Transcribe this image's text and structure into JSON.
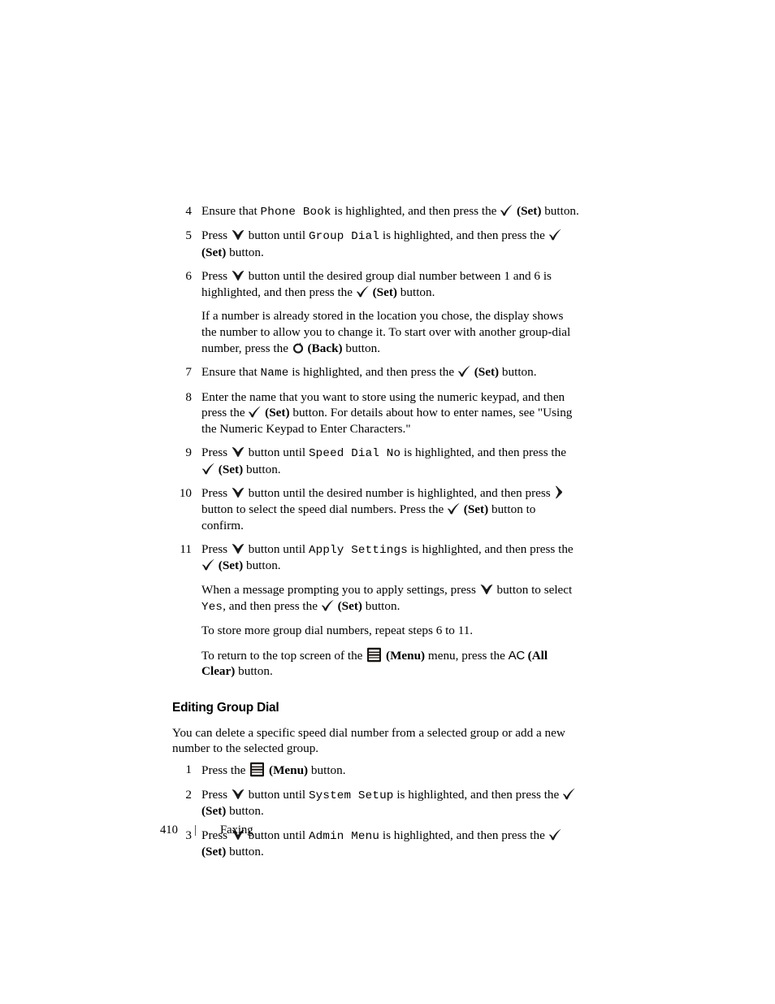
{
  "document": {
    "footer": {
      "page_number": "410",
      "separator": "|",
      "section": "Faxing"
    }
  },
  "icons": {
    "set": "checkmark-icon",
    "down": "down-arrow-icon",
    "back": "back-circular-arrow-icon",
    "right": "right-chevron-icon",
    "menu": "menu-icon",
    "all_clear": "AC"
  },
  "procedure_continued": {
    "steps": [
      {
        "number": "4",
        "parts": [
          {
            "t": "text",
            "v": "Ensure that "
          },
          {
            "t": "mono",
            "v": "Phone  Book"
          },
          {
            "t": "text",
            "v": " is highlighted, and then press the "
          },
          {
            "t": "icon",
            "v": "set"
          },
          {
            "t": "bold",
            "v": " (Set)"
          },
          {
            "t": "text",
            "v": " button."
          }
        ]
      },
      {
        "number": "5",
        "parts": [
          {
            "t": "text",
            "v": "Press "
          },
          {
            "t": "icon",
            "v": "down"
          },
          {
            "t": "text",
            "v": " button until "
          },
          {
            "t": "mono",
            "v": "Group  Dial"
          },
          {
            "t": "text",
            "v": " is highlighted, and then press the "
          },
          {
            "t": "icon",
            "v": "set"
          },
          {
            "t": "bold",
            "v": " (Set)"
          },
          {
            "t": "text",
            "v": " button."
          }
        ]
      },
      {
        "number": "6",
        "parts": [
          {
            "t": "text",
            "v": "Press "
          },
          {
            "t": "icon",
            "v": "down"
          },
          {
            "t": "text",
            "v": " button until the desired group dial number between 1 and 6 is highlighted, and then press the "
          },
          {
            "t": "icon",
            "v": "set"
          },
          {
            "t": "bold",
            "v": " (Set)"
          },
          {
            "t": "text",
            "v": " button."
          }
        ]
      }
    ],
    "note_after_six": [
      {
        "t": "text",
        "v": "If a number is already stored in the location you chose, the display shows the number to allow you to change it. To start over with another group-dial number, press the "
      },
      {
        "t": "icon",
        "v": "back"
      },
      {
        "t": "bold",
        "v": " (Back)"
      },
      {
        "t": "text",
        "v": " button."
      }
    ],
    "steps_cont": [
      {
        "number": "7",
        "parts": [
          {
            "t": "text",
            "v": "Ensure that "
          },
          {
            "t": "mono",
            "v": "Name"
          },
          {
            "t": "text",
            "v": " is highlighted, and then press the "
          },
          {
            "t": "icon",
            "v": "set"
          },
          {
            "t": "bold",
            "v": " (Set)"
          },
          {
            "t": "text",
            "v": " button."
          }
        ]
      },
      {
        "number": "8",
        "parts": [
          {
            "t": "text",
            "v": "Enter the name that you want to store using the numeric keypad, and then press the "
          },
          {
            "t": "icon",
            "v": "set"
          },
          {
            "t": "bold",
            "v": " (Set)"
          },
          {
            "t": "text",
            "v": " button. For details about how to enter names, see \"Using the Numeric Keypad to Enter Characters.\""
          }
        ]
      },
      {
        "number": "9",
        "parts": [
          {
            "t": "text",
            "v": "Press "
          },
          {
            "t": "icon",
            "v": "down"
          },
          {
            "t": "text",
            "v": " button until "
          },
          {
            "t": "mono",
            "v": "Speed  Dial  No"
          },
          {
            "t": "text",
            "v": " is highlighted, and then press the "
          },
          {
            "t": "icon",
            "v": "set"
          },
          {
            "t": "bold",
            "v": " (Set)"
          },
          {
            "t": "text",
            "v": " button."
          }
        ]
      },
      {
        "number": "10",
        "parts": [
          {
            "t": "text",
            "v": "Press "
          },
          {
            "t": "icon",
            "v": "down"
          },
          {
            "t": "text",
            "v": " button until the desired number is highlighted, and then press "
          },
          {
            "t": "icon",
            "v": "right"
          },
          {
            "t": "text",
            "v": " button to select the speed dial numbers. Press the "
          },
          {
            "t": "icon",
            "v": "set"
          },
          {
            "t": "bold",
            "v": " (Set)"
          },
          {
            "t": "text",
            "v": " button to confirm."
          }
        ]
      },
      {
        "number": "11",
        "parts": [
          {
            "t": "text",
            "v": "Press "
          },
          {
            "t": "icon",
            "v": "down"
          },
          {
            "t": "text",
            "v": " button until "
          },
          {
            "t": "mono",
            "v": "Apply  Settings"
          },
          {
            "t": "text",
            "v": " is highlighted, and then press the "
          },
          {
            "t": "icon",
            "v": "set"
          },
          {
            "t": "bold",
            "v": " (Set)"
          },
          {
            "t": "text",
            "v": " button."
          }
        ]
      }
    ],
    "note_apply": [
      {
        "t": "text",
        "v": "When a message prompting you to apply settings, press "
      },
      {
        "t": "icon",
        "v": "down"
      },
      {
        "t": "text",
        "v": " button to select "
      },
      {
        "t": "mono",
        "v": "Yes"
      },
      {
        "t": "text",
        "v": ", and then press the "
      },
      {
        "t": "icon",
        "v": "set"
      },
      {
        "t": "bold",
        "v": " (Set)"
      },
      {
        "t": "text",
        "v": " button."
      }
    ],
    "note_repeat": [
      {
        "t": "text",
        "v": "To store more group dial numbers, repeat steps 6 to 11."
      }
    ],
    "note_return": [
      {
        "t": "text",
        "v": "To return to the top screen of the "
      },
      {
        "t": "icon",
        "v": "menu"
      },
      {
        "t": "bold",
        "v": " (Menu)"
      },
      {
        "t": "text",
        "v": " menu, press the "
      },
      {
        "t": "icon",
        "v": "allclear"
      },
      {
        "t": "bold",
        "v": " (All Clear)"
      },
      {
        "t": "text",
        "v": " button."
      }
    ]
  },
  "editing_group_dial": {
    "heading": "Editing Group Dial",
    "intro": "You can delete a specific speed dial number from a selected group or add a new number to the selected group.",
    "steps": [
      {
        "number": "1",
        "parts": [
          {
            "t": "text",
            "v": "Press the "
          },
          {
            "t": "icon",
            "v": "menu"
          },
          {
            "t": "bold",
            "v": " (Menu)"
          },
          {
            "t": "text",
            "v": " button."
          }
        ]
      },
      {
        "number": "2",
        "parts": [
          {
            "t": "text",
            "v": "Press "
          },
          {
            "t": "icon",
            "v": "down"
          },
          {
            "t": "text",
            "v": " button until "
          },
          {
            "t": "mono",
            "v": "System  Setup"
          },
          {
            "t": "text",
            "v": " is highlighted, and then press the "
          },
          {
            "t": "icon",
            "v": "set"
          },
          {
            "t": "bold",
            "v": " (Set)"
          },
          {
            "t": "text",
            "v": " button."
          }
        ]
      },
      {
        "number": "3",
        "parts": [
          {
            "t": "text",
            "v": "Press "
          },
          {
            "t": "icon",
            "v": "down"
          },
          {
            "t": "text",
            "v": " button until "
          },
          {
            "t": "mono",
            "v": "Admin  Menu"
          },
          {
            "t": "text",
            "v": " is highlighted, and then press the "
          },
          {
            "t": "icon",
            "v": "set"
          },
          {
            "t": "bold",
            "v": " (Set)"
          },
          {
            "t": "text",
            "v": " button."
          }
        ]
      }
    ]
  }
}
